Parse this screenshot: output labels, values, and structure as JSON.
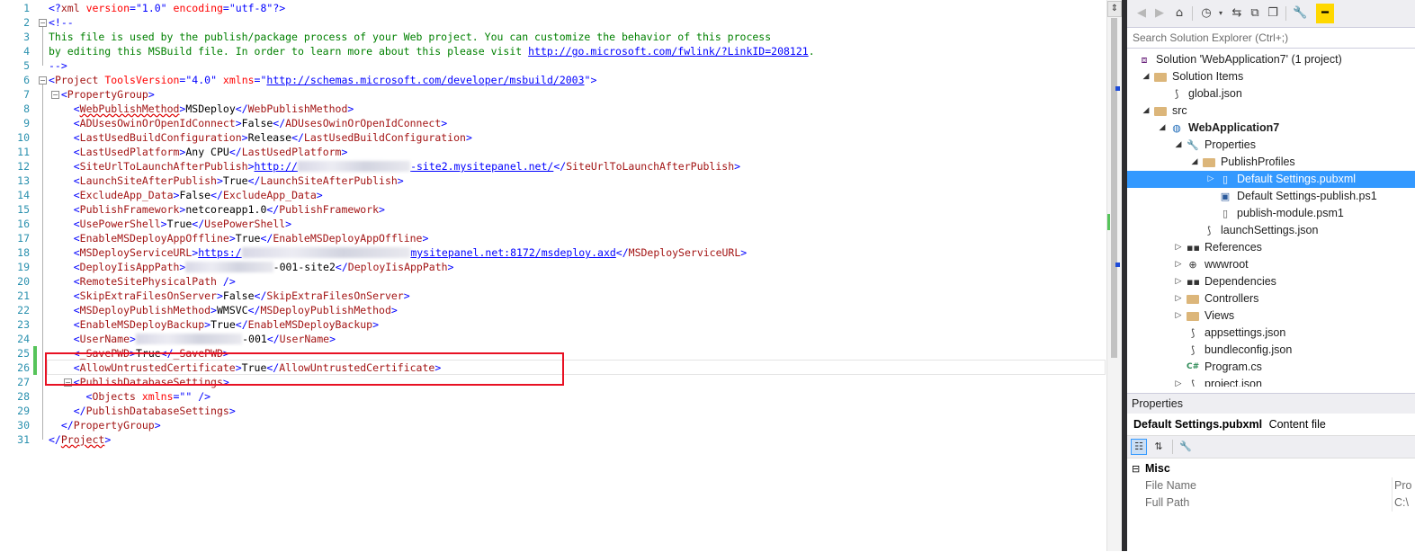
{
  "editor": {
    "lines": [
      {
        "n": "1",
        "segs": [
          [
            "p",
            "<?"
          ],
          [
            "t",
            "xml "
          ],
          [
            "a",
            "version"
          ],
          [
            "p",
            "=\""
          ],
          [
            "v",
            "1.0"
          ],
          [
            "p",
            "\" "
          ],
          [
            "a",
            "encoding"
          ],
          [
            "p",
            "=\""
          ],
          [
            "v",
            "utf-8"
          ],
          [
            "p",
            "\"?>"
          ]
        ]
      },
      {
        "n": "2",
        "segs": [
          [
            "p",
            "<!--"
          ]
        ]
      },
      {
        "n": "3",
        "segs": [
          [
            "c",
            "This file is used by the publish/package process of your Web project. You can customize the behavior of this process"
          ]
        ]
      },
      {
        "n": "4",
        "segs": [
          [
            "c",
            "by editing this MSBuild file. In order to learn more about this please visit "
          ],
          [
            "u",
            "http://go.microsoft.com/fwlink/?LinkID=208121"
          ],
          [
            "c",
            "."
          ]
        ]
      },
      {
        "n": "5",
        "segs": [
          [
            "p",
            "-->"
          ]
        ]
      },
      {
        "n": "6",
        "segs": [
          [
            "p",
            "<"
          ],
          [
            "t",
            "Project "
          ],
          [
            "a",
            "ToolsVersion"
          ],
          [
            "p",
            "=\""
          ],
          [
            "v",
            "4.0"
          ],
          [
            "p",
            "\" "
          ],
          [
            "a",
            "xmlns"
          ],
          [
            "p",
            "=\""
          ],
          [
            "u",
            "http://schemas.microsoft.com/developer/msbuild/2003"
          ],
          [
            "p",
            "\">"
          ]
        ]
      },
      {
        "n": "7",
        "segs": [
          [
            "x",
            "  "
          ],
          [
            "p",
            "<"
          ],
          [
            "t",
            "PropertyGroup"
          ],
          [
            "p",
            ">"
          ]
        ]
      },
      {
        "n": "8",
        "segs": [
          [
            "x",
            "    "
          ],
          [
            "p",
            "<"
          ],
          [
            "tsq",
            "WebPublishMethod"
          ],
          [
            "p",
            ">"
          ],
          [
            "x",
            "MSDeploy"
          ],
          [
            "p",
            "</"
          ],
          [
            "t",
            "WebPublishMethod"
          ],
          [
            "p",
            ">"
          ]
        ]
      },
      {
        "n": "9",
        "segs": [
          [
            "x",
            "    "
          ],
          [
            "p",
            "<"
          ],
          [
            "t",
            "ADUsesOwinOrOpenIdConnect"
          ],
          [
            "p",
            ">"
          ],
          [
            "x",
            "False"
          ],
          [
            "p",
            "</"
          ],
          [
            "t",
            "ADUsesOwinOrOpenIdConnect"
          ],
          [
            "p",
            ">"
          ]
        ]
      },
      {
        "n": "10",
        "segs": [
          [
            "x",
            "    "
          ],
          [
            "p",
            "<"
          ],
          [
            "t",
            "LastUsedBuildConfiguration"
          ],
          [
            "p",
            ">"
          ],
          [
            "x",
            "Release"
          ],
          [
            "p",
            "</"
          ],
          [
            "t",
            "LastUsedBuildConfiguration"
          ],
          [
            "p",
            ">"
          ]
        ]
      },
      {
        "n": "11",
        "segs": [
          [
            "x",
            "    "
          ],
          [
            "p",
            "<"
          ],
          [
            "t",
            "LastUsedPlatform"
          ],
          [
            "p",
            ">"
          ],
          [
            "x",
            "Any CPU"
          ],
          [
            "p",
            "</"
          ],
          [
            "t",
            "LastUsedPlatform"
          ],
          [
            "p",
            ">"
          ]
        ]
      },
      {
        "n": "12",
        "segs": [
          [
            "x",
            "    "
          ],
          [
            "p",
            "<"
          ],
          [
            "t",
            "SiteUrlToLaunchAfterPublish"
          ],
          [
            "p",
            ">"
          ],
          [
            "u",
            "http://"
          ],
          [
            "blur",
            "18"
          ],
          [
            "u",
            "-site2.mysitepanel.net/"
          ],
          [
            "p",
            "</"
          ],
          [
            "t",
            "SiteUrlToLaunchAfterPublish"
          ],
          [
            "p",
            ">"
          ]
        ]
      },
      {
        "n": "13",
        "segs": [
          [
            "x",
            "    "
          ],
          [
            "p",
            "<"
          ],
          [
            "t",
            "LaunchSiteAfterPublish"
          ],
          [
            "p",
            ">"
          ],
          [
            "x",
            "True"
          ],
          [
            "p",
            "</"
          ],
          [
            "t",
            "LaunchSiteAfterPublish"
          ],
          [
            "p",
            ">"
          ]
        ]
      },
      {
        "n": "14",
        "segs": [
          [
            "x",
            "    "
          ],
          [
            "p",
            "<"
          ],
          [
            "t",
            "ExcludeApp_Data"
          ],
          [
            "p",
            ">"
          ],
          [
            "x",
            "False"
          ],
          [
            "p",
            "</"
          ],
          [
            "t",
            "ExcludeApp_Data"
          ],
          [
            "p",
            ">"
          ]
        ]
      },
      {
        "n": "15",
        "segs": [
          [
            "x",
            "    "
          ],
          [
            "p",
            "<"
          ],
          [
            "t",
            "PublishFramework"
          ],
          [
            "p",
            ">"
          ],
          [
            "x",
            "netcoreapp1.0"
          ],
          [
            "p",
            "</"
          ],
          [
            "t",
            "PublishFramework"
          ],
          [
            "p",
            ">"
          ]
        ]
      },
      {
        "n": "16",
        "segs": [
          [
            "x",
            "    "
          ],
          [
            "p",
            "<"
          ],
          [
            "t",
            "UsePowerShell"
          ],
          [
            "p",
            ">"
          ],
          [
            "x",
            "True"
          ],
          [
            "p",
            "</"
          ],
          [
            "t",
            "UsePowerShell"
          ],
          [
            "p",
            ">"
          ]
        ]
      },
      {
        "n": "17",
        "segs": [
          [
            "x",
            "    "
          ],
          [
            "p",
            "<"
          ],
          [
            "t",
            "EnableMSDeployAppOffline"
          ],
          [
            "p",
            ">"
          ],
          [
            "x",
            "True"
          ],
          [
            "p",
            "</"
          ],
          [
            "t",
            "EnableMSDeployAppOffline"
          ],
          [
            "p",
            ">"
          ]
        ]
      },
      {
        "n": "18",
        "segs": [
          [
            "x",
            "    "
          ],
          [
            "p",
            "<"
          ],
          [
            "t",
            "MSDeployServiceURL"
          ],
          [
            "p",
            ">"
          ],
          [
            "u",
            "https:/"
          ],
          [
            "blur",
            "27"
          ],
          [
            "u",
            "mysitepanel.net:8172/msdeploy.axd"
          ],
          [
            "p",
            "</"
          ],
          [
            "t",
            "MSDeployServiceURL"
          ],
          [
            "p",
            ">"
          ]
        ]
      },
      {
        "n": "19",
        "segs": [
          [
            "x",
            "    "
          ],
          [
            "p",
            "<"
          ],
          [
            "t",
            "DeployIisAppPath"
          ],
          [
            "p",
            ">"
          ],
          [
            "blur",
            "14"
          ],
          [
            "x",
            "-001-site2"
          ],
          [
            "p",
            "</"
          ],
          [
            "t",
            "DeployIisAppPath"
          ],
          [
            "p",
            ">"
          ]
        ]
      },
      {
        "n": "20",
        "segs": [
          [
            "x",
            "    "
          ],
          [
            "p",
            "<"
          ],
          [
            "t",
            "RemoteSitePhysicalPath "
          ],
          [
            "p",
            "/>"
          ]
        ]
      },
      {
        "n": "21",
        "segs": [
          [
            "x",
            "    "
          ],
          [
            "p",
            "<"
          ],
          [
            "t",
            "SkipExtraFilesOnServer"
          ],
          [
            "p",
            ">"
          ],
          [
            "x",
            "False"
          ],
          [
            "p",
            "</"
          ],
          [
            "t",
            "SkipExtraFilesOnServer"
          ],
          [
            "p",
            ">"
          ]
        ]
      },
      {
        "n": "22",
        "segs": [
          [
            "x",
            "    "
          ],
          [
            "p",
            "<"
          ],
          [
            "t",
            "MSDeployPublishMethod"
          ],
          [
            "p",
            ">"
          ],
          [
            "x",
            "WMSVC"
          ],
          [
            "p",
            "</"
          ],
          [
            "t",
            "MSDeployPublishMethod"
          ],
          [
            "p",
            ">"
          ]
        ]
      },
      {
        "n": "23",
        "segs": [
          [
            "x",
            "    "
          ],
          [
            "p",
            "<"
          ],
          [
            "t",
            "EnableMSDeployBackup"
          ],
          [
            "p",
            ">"
          ],
          [
            "x",
            "True"
          ],
          [
            "p",
            "</"
          ],
          [
            "t",
            "EnableMSDeployBackup"
          ],
          [
            "p",
            ">"
          ]
        ]
      },
      {
        "n": "24",
        "segs": [
          [
            "x",
            "    "
          ],
          [
            "p",
            "<"
          ],
          [
            "t",
            "UserName"
          ],
          [
            "p",
            ">"
          ],
          [
            "blur",
            "17"
          ],
          [
            "x",
            "-001"
          ],
          [
            "p",
            "</"
          ],
          [
            "t",
            "UserName"
          ],
          [
            "p",
            ">"
          ]
        ]
      },
      {
        "n": "25",
        "segs": [
          [
            "x",
            "    "
          ],
          [
            "p",
            "<"
          ],
          [
            "t",
            "_SavePWD"
          ],
          [
            "p",
            ">"
          ],
          [
            "x",
            "True"
          ],
          [
            "p",
            "</"
          ],
          [
            "t",
            "_SavePWD"
          ],
          [
            "p",
            ">"
          ]
        ]
      },
      {
        "n": "26",
        "segs": [
          [
            "x",
            "    "
          ],
          [
            "p",
            "<"
          ],
          [
            "t",
            "AllowUntrustedCertificate"
          ],
          [
            "p",
            ">"
          ],
          [
            "x",
            "True"
          ],
          [
            "p",
            "</"
          ],
          [
            "t",
            "AllowUntrustedCertificate"
          ],
          [
            "p",
            ">"
          ]
        ]
      },
      {
        "n": "27",
        "segs": [
          [
            "x",
            "    "
          ],
          [
            "p",
            "<"
          ],
          [
            "t",
            "PublishDatabaseSettings"
          ],
          [
            "p",
            ">"
          ]
        ]
      },
      {
        "n": "28",
        "segs": [
          [
            "x",
            "      "
          ],
          [
            "p",
            "<"
          ],
          [
            "t",
            "Objects "
          ],
          [
            "a",
            "xmlns"
          ],
          [
            "p",
            "=\"\" />"
          ]
        ]
      },
      {
        "n": "29",
        "segs": [
          [
            "x",
            "    "
          ],
          [
            "p",
            "</"
          ],
          [
            "t",
            "PublishDatabaseSettings"
          ],
          [
            "p",
            ">"
          ]
        ]
      },
      {
        "n": "30",
        "segs": [
          [
            "x",
            "  "
          ],
          [
            "p",
            "</"
          ],
          [
            "t",
            "PropertyGroup"
          ],
          [
            "p",
            ">"
          ]
        ]
      },
      {
        "n": "31",
        "segs": [
          [
            "p",
            "</"
          ],
          [
            "tsq",
            "Project"
          ],
          [
            "p",
            ">"
          ]
        ]
      }
    ],
    "changed_lines": [
      "25",
      "26"
    ],
    "colors": {
      "tag": "#a31515",
      "attr": "#ff0000",
      "value": "#0000ff",
      "punct": "#0000ff",
      "comment": "#008000",
      "line_number": "#2b91af",
      "highlight_box": "#e81123",
      "change_marker": "#56c45a"
    }
  },
  "solution_explorer": {
    "search_placeholder": "Search Solution Explorer (Ctrl+;)",
    "toolbar": [
      "back-icon",
      "forward-icon",
      "home-icon",
      "history-icon",
      "sync-icon",
      "collapse-all-icon",
      "show-all-files-icon",
      "properties-wrench-icon",
      "pin-icon"
    ],
    "items": [
      {
        "label": "Solution 'WebApplication7' (1 project)",
        "depth": 0,
        "arrow": "",
        "icon": "solution-icon"
      },
      {
        "label": "Solution Items",
        "depth": 1,
        "arrow": "expanded",
        "icon": "folder-icon"
      },
      {
        "label": "global.json",
        "depth": 2,
        "arrow": "",
        "icon": "json-file-icon"
      },
      {
        "label": "src",
        "depth": 1,
        "arrow": "expanded",
        "icon": "folder-icon"
      },
      {
        "label": "WebApplication7",
        "depth": 2,
        "arrow": "expanded",
        "icon": "web-project-icon",
        "bold": true
      },
      {
        "label": "Properties",
        "depth": 3,
        "arrow": "expanded",
        "icon": "wrench-icon"
      },
      {
        "label": "PublishProfiles",
        "depth": 4,
        "arrow": "expanded",
        "icon": "folder-icon"
      },
      {
        "label": "Default Settings.pubxml",
        "depth": 5,
        "arrow": "collapsed",
        "icon": "pubxml-file-icon",
        "selected": true
      },
      {
        "label": "Default Settings-publish.ps1",
        "depth": 5,
        "arrow": "",
        "icon": "ps1-file-icon"
      },
      {
        "label": "publish-module.psm1",
        "depth": 5,
        "arrow": "",
        "icon": "file-icon"
      },
      {
        "label": "launchSettings.json",
        "depth": 4,
        "arrow": "",
        "icon": "json-file-icon"
      },
      {
        "label": "References",
        "depth": 3,
        "arrow": "collapsed",
        "icon": "references-icon"
      },
      {
        "label": "wwwroot",
        "depth": 3,
        "arrow": "collapsed",
        "icon": "globe-icon"
      },
      {
        "label": "Dependencies",
        "depth": 3,
        "arrow": "collapsed",
        "icon": "references-icon"
      },
      {
        "label": "Controllers",
        "depth": 3,
        "arrow": "collapsed",
        "icon": "folder-icon"
      },
      {
        "label": "Views",
        "depth": 3,
        "arrow": "collapsed",
        "icon": "folder-icon"
      },
      {
        "label": "appsettings.json",
        "depth": 3,
        "arrow": "",
        "icon": "json-file-icon"
      },
      {
        "label": "bundleconfig.json",
        "depth": 3,
        "arrow": "",
        "icon": "json-file-icon"
      },
      {
        "label": "Program.cs",
        "depth": 3,
        "arrow": "",
        "icon": "csharp-file-icon"
      },
      {
        "label": "project.json",
        "depth": 3,
        "arrow": "collapsed",
        "icon": "json-file-icon"
      }
    ],
    "selected_color": "#3399ff"
  },
  "properties": {
    "title": "Properties",
    "object_name": "Default Settings.pubxml",
    "object_type": "Content file",
    "category": "Misc",
    "rows": [
      {
        "name": "File Name",
        "value": "Pro"
      },
      {
        "name": "Full Path",
        "value": "C:\\"
      }
    ]
  }
}
